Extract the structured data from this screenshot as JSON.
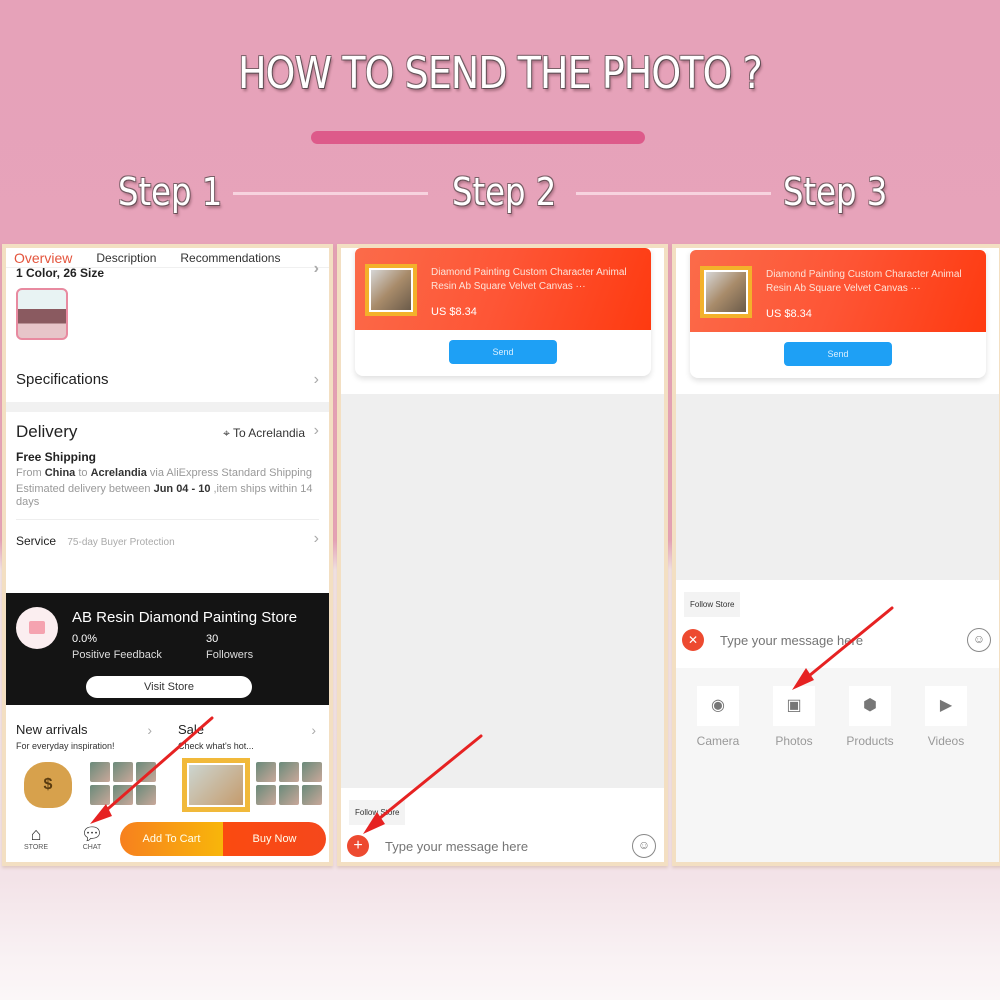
{
  "header": {
    "title": "HOW TO SEND THE PHOTO ?",
    "steps": [
      "Step 1",
      "Step 2",
      "Step 3"
    ]
  },
  "colors": {
    "accent_bar": "#dd5a8a",
    "app_orange": "#fe5535",
    "send_blue": "#1ea0f5",
    "arrow_red": "#e62222"
  },
  "step1": {
    "tabs": [
      "Overview",
      "Description",
      "Recommendations"
    ],
    "active_tab": "Overview",
    "variant_summary": "1 Color, 26 Size",
    "specifications_label": "Specifications",
    "delivery": {
      "heading": "Delivery",
      "location": "To Acrelandia",
      "free_shipping": "Free Shipping",
      "from_pre": "From ",
      "from_country": "China",
      "to_pre": " to ",
      "to_place": "Acrelandia",
      "via": " via AliExpress Standard Shipping",
      "est_pre": "Estimated delivery between ",
      "est_dates": "Jun 04 - 10",
      "est_post": " ,item ships within 14 days"
    },
    "service": {
      "label": "Service",
      "value": "75-day Buyer Protection"
    },
    "store": {
      "name": "AB Resin Diamond Painting Store",
      "feedback_value": "0.0%",
      "feedback_label": "Positive Feedback",
      "followers_value": "30",
      "followers_label": "Followers",
      "visit_label": "Visit Store"
    },
    "promo": {
      "new_title": "New arrivals",
      "new_sub": "For everyday inspiration!",
      "sale_title": "Sale",
      "sale_sub": "Check what's hot..."
    },
    "bottom": {
      "store_label": "STORE",
      "chat_label": "CHAT",
      "add_to_cart": "Add To Cart",
      "buy_now": "Buy Now"
    }
  },
  "product_card": {
    "title": "Diamond Painting Custom Character Animal Resin Ab Square Velvet Canvas ···",
    "price": "US $8.34",
    "send_label": "Send"
  },
  "chat": {
    "follow_store": "Follow Store",
    "message_placeholder": "Type your message here"
  },
  "step3": {
    "attachments": [
      "Camera",
      "Photos",
      "Products",
      "Videos"
    ]
  }
}
